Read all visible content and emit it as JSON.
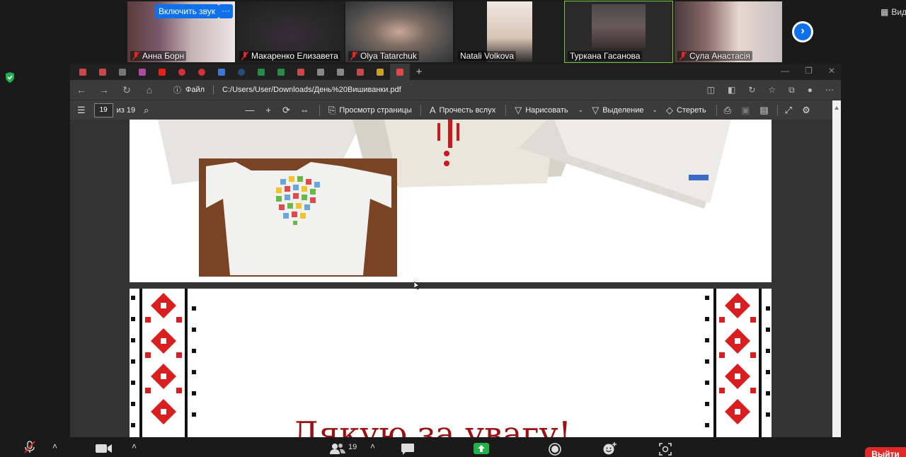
{
  "gallery": {
    "unmute_label": "Включить звук",
    "more_label": "···",
    "view_label": "Вид",
    "participants": [
      {
        "name": "Анна Борн",
        "muted": true
      },
      {
        "name": "Макаренко Елизавета",
        "muted": true
      },
      {
        "name": "Olya Tatarchuk",
        "muted": true
      },
      {
        "name": "Natali Volkova",
        "muted": false
      },
      {
        "name": "Туркана Гасанова",
        "muted": false
      },
      {
        "name": "Сула Анастасія",
        "muted": true
      }
    ]
  },
  "browser": {
    "address": {
      "file_label": "Файл",
      "url": "C:/Users/User/Downloads/День%20Вишиванки.pdf"
    },
    "pdf_toolbar": {
      "page_current": "19",
      "page_total": "из 19",
      "page_view_label": "Просмотр страницы",
      "read_aloud_label": "Прочесть вслух",
      "draw_label": "Нарисовать",
      "highlight_label": "Выделение",
      "erase_label": "Стереть"
    },
    "pdf_content": {
      "thanks_text": "Дякую за увагу!"
    }
  },
  "zoom_toolbar": {
    "participants_count": "19",
    "leave_label": "Выйти"
  },
  "colors": {
    "zoom_blue": "#0e71eb",
    "leave_red": "#e02828",
    "thanks_red": "#9b1010",
    "share_green": "#21b14b"
  }
}
